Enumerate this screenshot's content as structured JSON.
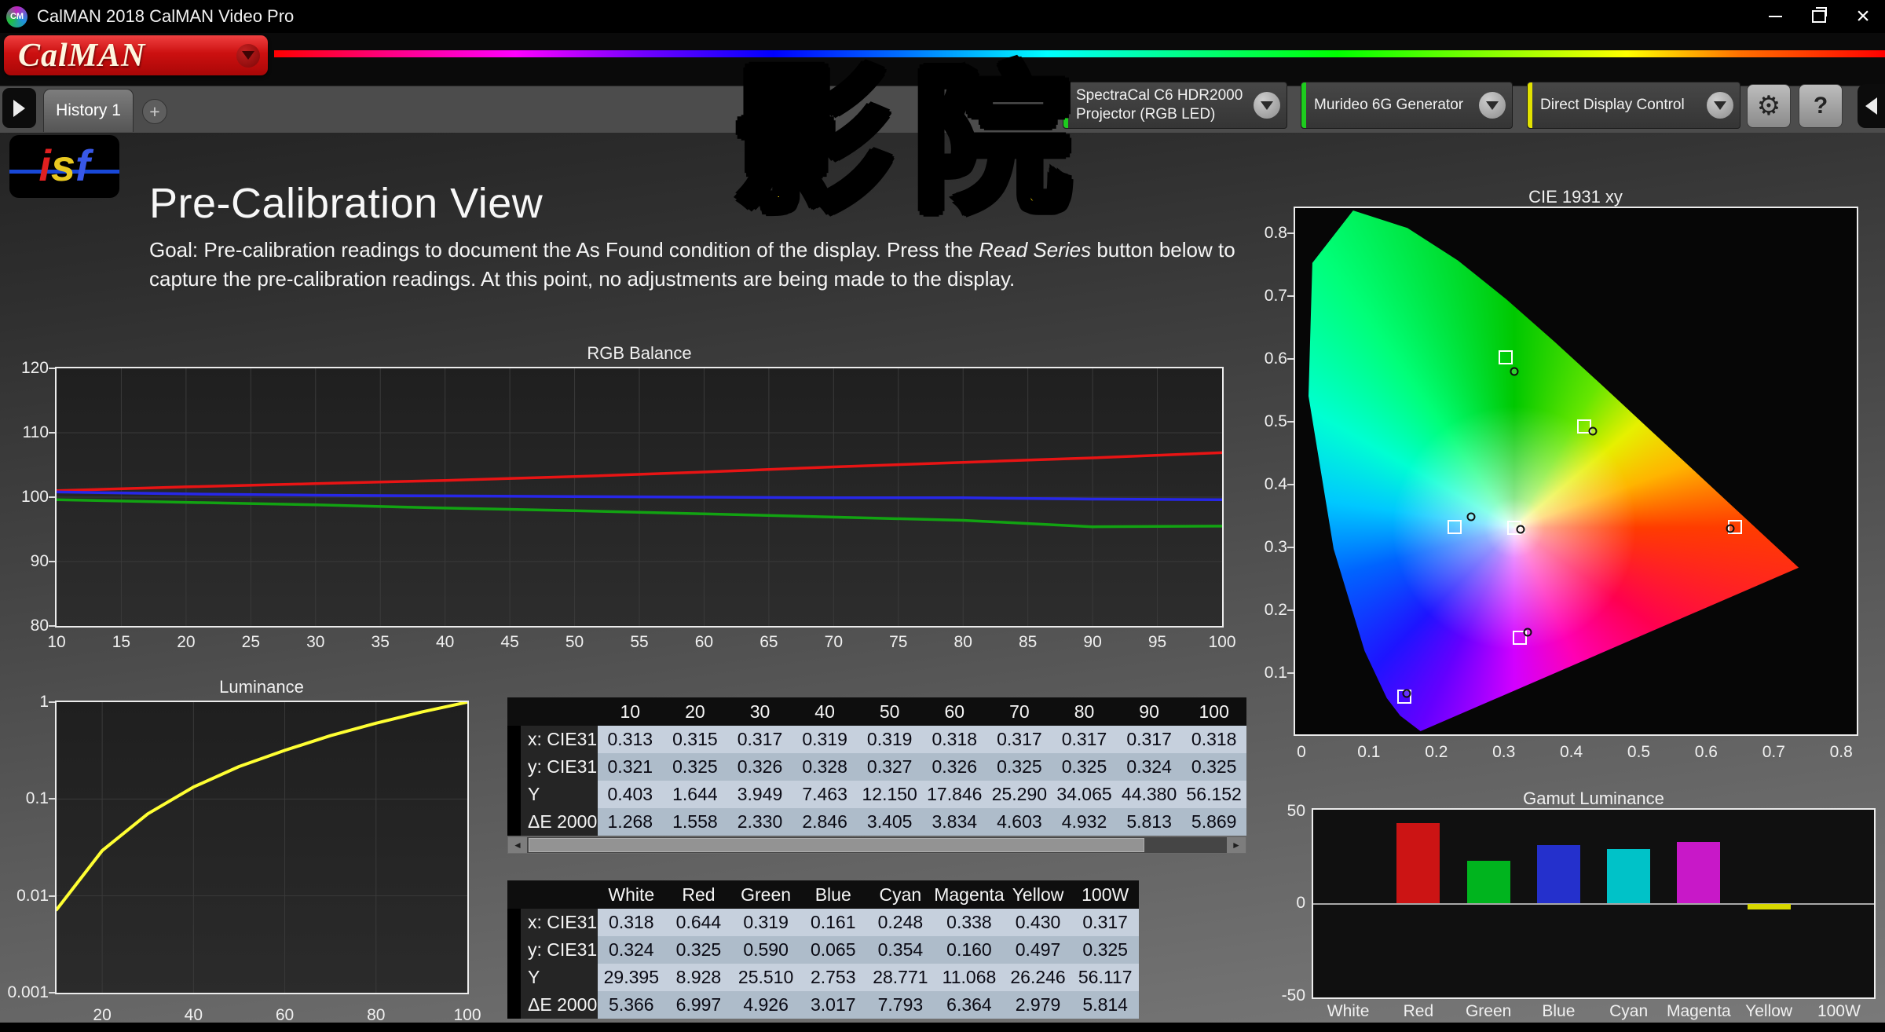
{
  "window": {
    "title": "CalMAN 2018 CalMAN Video Pro",
    "close_glyph": "×"
  },
  "brand": {
    "calman": "CalMAN",
    "isf_i": "i",
    "isf_s": "s",
    "isf_f": "f"
  },
  "overlay": {
    "text": "影院"
  },
  "tabs": {
    "history": "History 1",
    "add": "+"
  },
  "toolbar": {
    "meter_line1": "SpectraCal C6 HDR2000",
    "meter_line2": "Projector (RGB LED)",
    "source": "Murideo 6G Generator",
    "display_control": "Direct Display Control",
    "gear_glyph": "⚙",
    "help_glyph": "?"
  },
  "page": {
    "title": "Pre-Calibration View",
    "goal_prefix": "Goal: Pre-calibration readings to document the As Found condition of the display. Press the ",
    "goal_italic": "Read Series",
    "goal_suffix": " button below to capture the pre-calibration readings. At this point, no adjustments are being made to the display."
  },
  "scrollbar": {
    "left_glyph": "◄",
    "right_glyph": "►"
  },
  "chart_data": [
    {
      "type": "line",
      "title": "RGB Balance",
      "x": [
        10,
        20,
        30,
        40,
        50,
        60,
        70,
        80,
        90,
        100
      ],
      "series": [
        {
          "name": "Red",
          "color": "#e81414",
          "values": [
            101.0,
            101.6,
            102.1,
            102.6,
            103.2,
            103.9,
            104.7,
            105.4,
            106.1,
            106.9
          ]
        },
        {
          "name": "Green",
          "color": "#12a312",
          "values": [
            99.6,
            99.2,
            98.8,
            98.3,
            97.9,
            97.4,
            96.9,
            96.4,
            95.4,
            95.5
          ]
        },
        {
          "name": "Blue",
          "color": "#2727e8",
          "values": [
            100.8,
            100.5,
            100.3,
            100.2,
            100.1,
            100.0,
            99.9,
            99.9,
            99.7,
            99.6
          ]
        }
      ],
      "xticks": [
        10,
        15,
        20,
        25,
        30,
        35,
        40,
        45,
        50,
        55,
        60,
        65,
        70,
        75,
        80,
        85,
        90,
        95,
        100
      ],
      "ylim": [
        80,
        120
      ],
      "yticks": [
        120,
        110,
        100,
        90,
        80
      ]
    },
    {
      "type": "line",
      "title": "Luminance",
      "x": [
        10,
        20,
        30,
        40,
        50,
        60,
        70,
        80,
        90,
        100
      ],
      "series": [
        {
          "name": "Luminance",
          "color": "#ffff33",
          "values": [
            0.0072,
            0.0293,
            0.0703,
            0.1329,
            0.2164,
            0.3178,
            0.4504,
            0.6066,
            0.7903,
            1.0
          ]
        }
      ],
      "yscale": "log",
      "ylim": [
        0.001,
        1
      ],
      "yticks": [
        1,
        0.1,
        0.01,
        0.001
      ],
      "xticks": [
        20,
        40,
        60,
        80,
        100
      ]
    },
    {
      "type": "scatter",
      "title": "CIE 1931 xy",
      "xlim": [
        0,
        0.8
      ],
      "ylim": [
        0,
        0.8
      ],
      "xticks": [
        0,
        0.1,
        0.2,
        0.3,
        0.4,
        0.5,
        0.6,
        0.7,
        0.8
      ],
      "yticks": [
        0.8,
        0.7,
        0.6,
        0.5,
        0.4,
        0.3,
        0.2,
        0.1
      ],
      "targets": [
        {
          "name": "white",
          "x": 0.313,
          "y": 0.329
        },
        {
          "name": "red",
          "x": 0.64,
          "y": 0.33
        },
        {
          "name": "green",
          "x": 0.3,
          "y": 0.6
        },
        {
          "name": "blue",
          "x": 0.15,
          "y": 0.06
        },
        {
          "name": "cyan",
          "x": 0.225,
          "y": 0.33
        },
        {
          "name": "magenta",
          "x": 0.321,
          "y": 0.154
        },
        {
          "name": "yellow",
          "x": 0.417,
          "y": 0.49
        }
      ],
      "measurements": [
        {
          "name": "white",
          "x": 0.322,
          "y": 0.326
        },
        {
          "name": "red",
          "x": 0.633,
          "y": 0.327
        },
        {
          "name": "green",
          "x": 0.313,
          "y": 0.578
        },
        {
          "name": "blue",
          "x": 0.154,
          "y": 0.065
        },
        {
          "name": "cyan",
          "x": 0.249,
          "y": 0.346
        },
        {
          "name": "magenta",
          "x": 0.333,
          "y": 0.162
        },
        {
          "name": "yellow",
          "x": 0.43,
          "y": 0.482
        }
      ]
    },
    {
      "type": "bar",
      "title": "Gamut Luminance",
      "categories": [
        "White",
        "Red",
        "Green",
        "Blue",
        "Cyan",
        "Magenta",
        "Yellow",
        "100W"
      ],
      "values": [
        0,
        43,
        23,
        31,
        29,
        33,
        -3,
        0
      ],
      "colors": [
        "#ffffff",
        "#cc1414",
        "#00b41e",
        "#2430cc",
        "#00c2c8",
        "#c818c8",
        "#d8d800",
        "#ffffff"
      ],
      "ylim": [
        -50,
        50
      ],
      "yticks": [
        50,
        0,
        -50
      ]
    }
  ],
  "tables": {
    "grayscale": {
      "headers": [
        "10",
        "20",
        "30",
        "40",
        "50",
        "60",
        "70",
        "80",
        "90",
        "100"
      ],
      "rows": [
        {
          "label": "x: CIE31",
          "values": [
            "0.313",
            "0.315",
            "0.317",
            "0.319",
            "0.319",
            "0.318",
            "0.317",
            "0.317",
            "0.317",
            "0.318"
          ]
        },
        {
          "label": "y: CIE31",
          "values": [
            "0.321",
            "0.325",
            "0.326",
            "0.328",
            "0.327",
            "0.326",
            "0.325",
            "0.325",
            "0.324",
            "0.325"
          ]
        },
        {
          "label": "Y",
          "values": [
            "0.403",
            "1.644",
            "3.949",
            "7.463",
            "12.150",
            "17.846",
            "25.290",
            "34.065",
            "44.380",
            "56.152"
          ]
        },
        {
          "label": "ΔE 2000",
          "values": [
            "1.268",
            "1.558",
            "2.330",
            "2.846",
            "3.405",
            "3.834",
            "4.603",
            "4.932",
            "5.813",
            "5.869"
          ]
        }
      ]
    },
    "gamut": {
      "headers": [
        "White",
        "Red",
        "Green",
        "Blue",
        "Cyan",
        "Magenta",
        "Yellow",
        "100W"
      ],
      "rows": [
        {
          "label": "x: CIE31",
          "values": [
            "0.318",
            "0.644",
            "0.319",
            "0.161",
            "0.248",
            "0.338",
            "0.430",
            "0.317"
          ]
        },
        {
          "label": "y: CIE31",
          "values": [
            "0.324",
            "0.325",
            "0.590",
            "0.065",
            "0.354",
            "0.160",
            "0.497",
            "0.325"
          ]
        },
        {
          "label": "Y",
          "values": [
            "29.395",
            "8.928",
            "25.510",
            "2.753",
            "28.771",
            "11.068",
            "26.246",
            "56.117"
          ]
        },
        {
          "label": "ΔE 2000",
          "values": [
            "5.366",
            "6.997",
            "4.926",
            "3.017",
            "7.793",
            "6.364",
            "2.979",
            "5.814"
          ]
        }
      ]
    }
  }
}
